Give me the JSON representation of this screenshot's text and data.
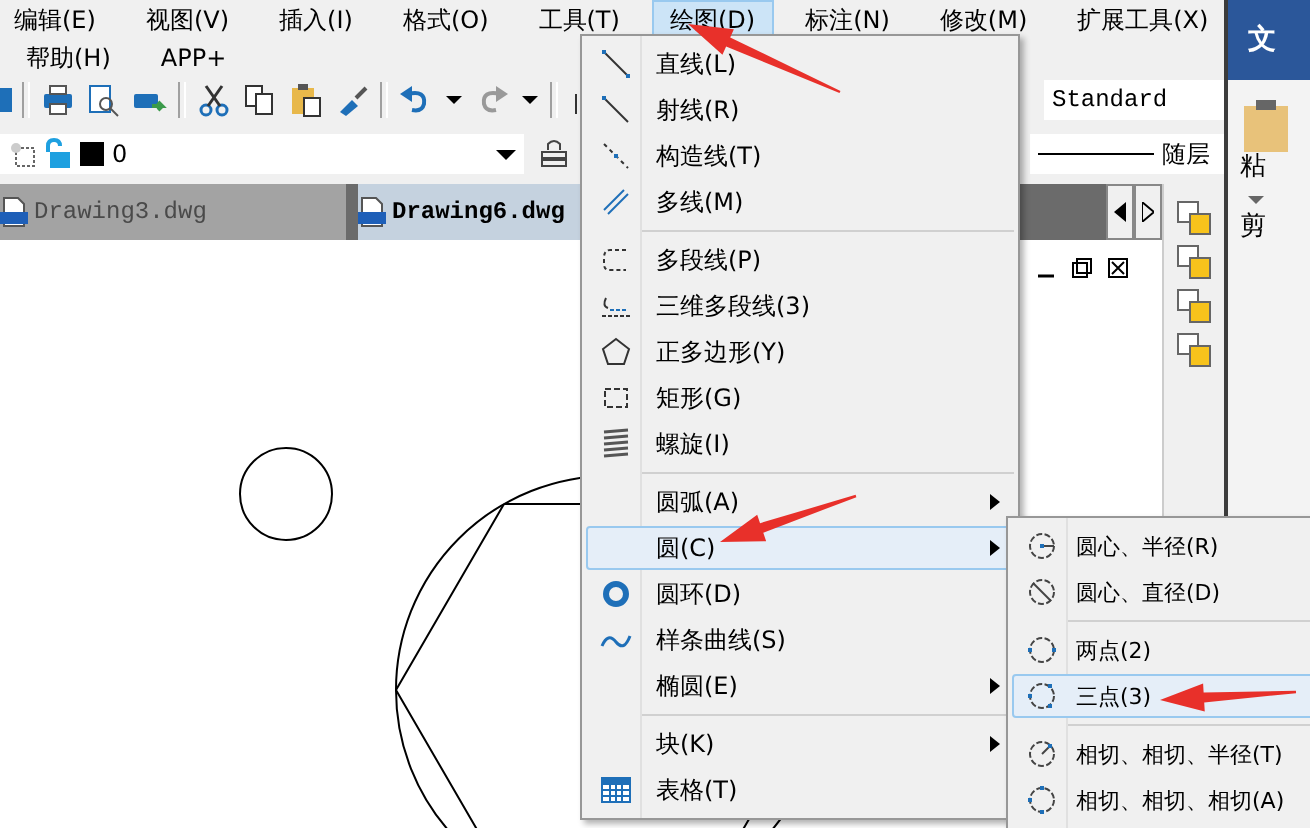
{
  "menu_bar": {
    "rows": [
      [
        {
          "label": "编辑(E)",
          "selected": false
        },
        {
          "label": "视图(V)",
          "selected": false
        },
        {
          "label": "插入(I)",
          "selected": false
        },
        {
          "label": "格式(O)",
          "selected": false
        },
        {
          "label": "工具(T)",
          "selected": false
        },
        {
          "label": "绘图(D)",
          "selected": true
        },
        {
          "label": "标注(N)",
          "selected": false
        },
        {
          "label": "修改(M)",
          "selected": false
        },
        {
          "label": "扩展工具(X)",
          "selected": false
        }
      ],
      [
        {
          "label": "帮助(H)",
          "selected": false
        },
        {
          "label": "APP+",
          "selected": false
        }
      ]
    ]
  },
  "layer_bar": {
    "layer": "0"
  },
  "style_bar": {
    "text_style": "Standard",
    "linetype": "随层"
  },
  "document_tabs": [
    {
      "label": "Drawing3.dwg",
      "selected": false
    },
    {
      "label": "Drawing6.dwg",
      "selected": true
    }
  ],
  "side_ribbon": {
    "tab": "文",
    "paste_label": "粘",
    "group_label": "剪"
  },
  "draw_menu": {
    "items": [
      {
        "kind": "item",
        "label": "直线(L)",
        "submenu": false,
        "selected": false
      },
      {
        "kind": "item",
        "label": "射线(R)",
        "submenu": false,
        "selected": false
      },
      {
        "kind": "item",
        "label": "构造线(T)",
        "submenu": false,
        "selected": false
      },
      {
        "kind": "item",
        "label": "多线(M)",
        "submenu": false,
        "selected": false
      },
      {
        "kind": "separator"
      },
      {
        "kind": "item",
        "label": "多段线(P)",
        "submenu": false,
        "selected": false
      },
      {
        "kind": "item",
        "label": "三维多段线(3)",
        "submenu": false,
        "selected": false
      },
      {
        "kind": "item",
        "label": "正多边形(Y)",
        "submenu": false,
        "selected": false
      },
      {
        "kind": "item",
        "label": "矩形(G)",
        "submenu": false,
        "selected": false
      },
      {
        "kind": "item",
        "label": "螺旋(I)",
        "submenu": false,
        "selected": false
      },
      {
        "kind": "separator"
      },
      {
        "kind": "item",
        "label": "圆弧(A)",
        "submenu": true,
        "selected": false
      },
      {
        "kind": "item",
        "label": "圆(C)",
        "submenu": true,
        "selected": true
      },
      {
        "kind": "item",
        "label": "圆环(D)",
        "submenu": false,
        "selected": false
      },
      {
        "kind": "item",
        "label": "样条曲线(S)",
        "submenu": false,
        "selected": false
      },
      {
        "kind": "item",
        "label": "椭圆(E)",
        "submenu": true,
        "selected": false
      },
      {
        "kind": "separator"
      },
      {
        "kind": "item",
        "label": "块(K)",
        "submenu": true,
        "selected": false
      },
      {
        "kind": "item",
        "label": "表格(T)",
        "submenu": false,
        "selected": false
      }
    ]
  },
  "circle_submenu": {
    "items": [
      {
        "kind": "item",
        "label": "圆心、半径(R)",
        "selected": false
      },
      {
        "kind": "item",
        "label": "圆心、直径(D)",
        "selected": false
      },
      {
        "kind": "separator"
      },
      {
        "kind": "item",
        "label": "两点(2)",
        "selected": false
      },
      {
        "kind": "item",
        "label": "三点(3)",
        "selected": true
      },
      {
        "kind": "separator"
      },
      {
        "kind": "item",
        "label": "相切、相切、半径(T)",
        "selected": false
      },
      {
        "kind": "item",
        "label": "相切、相切、相切(A)",
        "selected": false
      }
    ]
  }
}
